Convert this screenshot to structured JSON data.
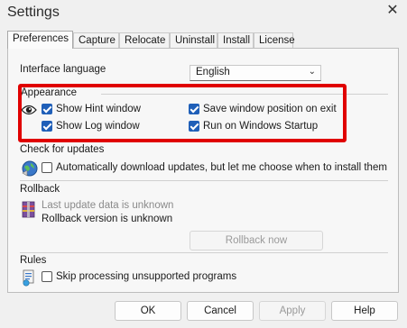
{
  "window": {
    "title": "Settings"
  },
  "tabs": [
    "Preferences",
    "Capture",
    "Relocate",
    "Uninstall",
    "Install",
    "License"
  ],
  "interface_language": {
    "label": "Interface language",
    "value": "English"
  },
  "appearance": {
    "title": "Appearance",
    "options": [
      {
        "label": "Show Hint window",
        "checked": true
      },
      {
        "label": "Save window position on exit",
        "checked": true
      },
      {
        "label": "Show Log window",
        "checked": true
      },
      {
        "label": "Run on Windows Startup",
        "checked": true
      }
    ]
  },
  "updates": {
    "title": "Check for updates",
    "auto_label": "Automatically download updates, but let me choose when to install them",
    "checked": false
  },
  "rollback": {
    "title": "Rollback",
    "last_update": "Last update data is unknown",
    "version": "Rollback version is unknown",
    "button": "Rollback now"
  },
  "rules": {
    "title": "Rules",
    "skip_label": "Skip processing unsupported programs",
    "checked": false
  },
  "buttons": {
    "ok": "OK",
    "cancel": "Cancel",
    "apply": "Apply",
    "help": "Help"
  },
  "colors": {
    "highlight": "#e00000",
    "checkbox": "#1f5fb8"
  }
}
